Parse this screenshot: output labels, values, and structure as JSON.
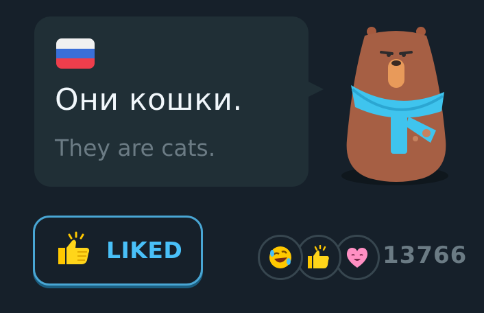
{
  "card": {
    "sentence": "Они кошки.",
    "translation": "They are cats.",
    "flag_icon": "russia-flag-icon",
    "flag_colors": [
      "#f1f1f1",
      "#3a6fd8",
      "#ee3e4c"
    ]
  },
  "character": {
    "icon": "bear-character-icon",
    "scarf_color": "#3fc4ee"
  },
  "like_button": {
    "label": "LIKED",
    "icon": "thumbs-up-icon",
    "accent": "#49c0f8"
  },
  "reactions": {
    "icons": [
      "laughing-emoji-icon",
      "thumbs-up-emoji-icon",
      "heart-eyes-emoji-icon"
    ],
    "count": "13766"
  }
}
